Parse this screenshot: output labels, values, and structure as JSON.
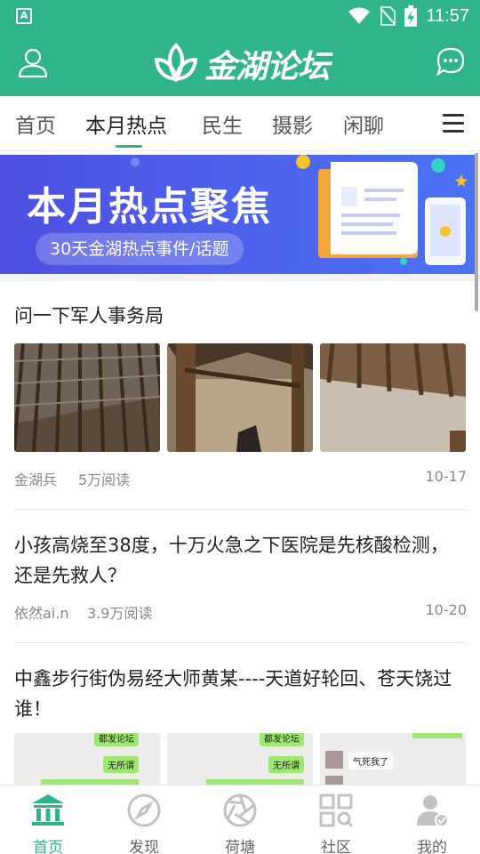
{
  "status_bar": {
    "time": "11:57",
    "icons": [
      "app-icon",
      "wifi-icon",
      "no-sim-icon",
      "battery-charging-icon"
    ]
  },
  "header": {
    "logo_text": "金湖论坛",
    "left_icon": "user-icon",
    "right_icon": "message-icon"
  },
  "tabs": [
    {
      "label": "首页"
    },
    {
      "label": "本月热点",
      "active": true
    },
    {
      "label": "民生"
    },
    {
      "label": "摄影"
    },
    {
      "label": "闲聊"
    }
  ],
  "banner": {
    "title": "本月热点聚焦",
    "subtitle": "30天金湖热点事件/话题"
  },
  "posts": [
    {
      "title": "问一下军人事务局",
      "author": "金湖兵",
      "reads": "5万阅读",
      "date": "10-17"
    },
    {
      "title": "小孩高烧至38度，十万火急之下医院是先核酸检测，还是先救人？",
      "author": "依然ai.n",
      "reads": "3.9万阅读",
      "date": "10-20"
    },
    {
      "title": "中鑫步行街伪易经大师黄某----天道好轮回、苍天饶过谁！"
    }
  ],
  "chat_thumbs": {
    "t1": [
      "都发论坛",
      "无所谓"
    ],
    "t2": [
      "都发论坛",
      "无所谓"
    ],
    "t3": [
      "气死我了"
    ]
  },
  "bottom_nav": [
    {
      "label": "首页",
      "icon": "bank-icon",
      "active": true
    },
    {
      "label": "发现",
      "icon": "compass-icon"
    },
    {
      "label": "荷塘",
      "icon": "aperture-icon"
    },
    {
      "label": "社区",
      "icon": "grid-search-icon"
    },
    {
      "label": "我的",
      "icon": "user-check-icon"
    }
  ],
  "colors": {
    "brand": "#30b58a",
    "banner": "#4d5ee8",
    "text": "#222222",
    "muted": "#888888"
  }
}
